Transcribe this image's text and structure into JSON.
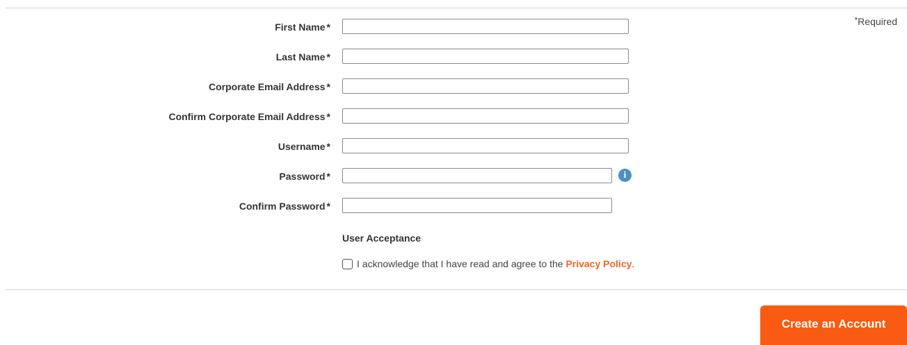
{
  "required_note": {
    "star": "*",
    "text": "Required"
  },
  "fields": {
    "first_name": {
      "label": "First Name",
      "asterisk": "*",
      "value": "",
      "placeholder": ""
    },
    "last_name": {
      "label": "Last Name",
      "asterisk": "*",
      "value": "",
      "placeholder": ""
    },
    "corporate_email": {
      "label": "Corporate Email Address",
      "asterisk": "*",
      "value": "",
      "placeholder": ""
    },
    "confirm_corporate_email": {
      "label": "Confirm Corporate Email Address",
      "asterisk": "*",
      "value": "",
      "placeholder": ""
    },
    "username": {
      "label": "Username",
      "asterisk": "*",
      "value": "",
      "placeholder": ""
    },
    "password": {
      "label": "Password",
      "asterisk": "*",
      "value": "",
      "placeholder": ""
    },
    "confirm_password": {
      "label": "Confirm Password",
      "asterisk": "*",
      "value": "",
      "placeholder": ""
    }
  },
  "password_info_icon": {
    "icon": "info-icon",
    "glyph": "i",
    "color": "#4a90c8"
  },
  "user_acceptance": {
    "title": "User Acceptance",
    "checked": false,
    "text_before": "I acknowledge that I have read and agree to the ",
    "link_text": "Privacy Policy",
    "text_after": "."
  },
  "submit_button": {
    "label": "Create an Account",
    "color": "#f95b12"
  },
  "colors": {
    "accent": "#f26522",
    "text": "#333333",
    "divider": "#d2d2d2"
  }
}
